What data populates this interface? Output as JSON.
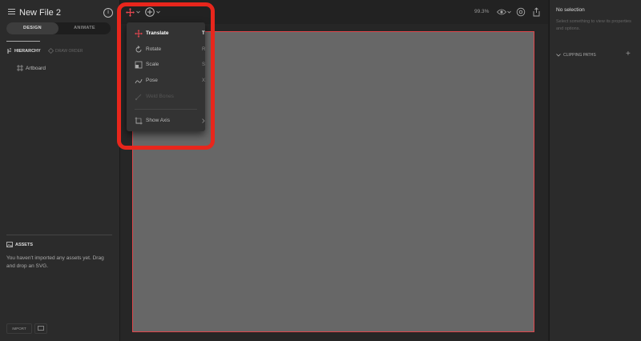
{
  "app": {
    "title": "New File 2"
  },
  "left_panel": {
    "mode_tabs": [
      "DESIGN",
      "ANIMATE"
    ],
    "view_tabs": [
      "HIERARCHY",
      "DRAW ORDER"
    ],
    "hierarchy_items": [
      "Artboard"
    ],
    "assets": {
      "heading": "ASSETS",
      "message": "You haven't imported any assets yet. Drag and drop an SVG.",
      "import_label": "IMPORT"
    }
  },
  "toolbar": {
    "zoom": "99.3%"
  },
  "transform_menu": {
    "items": [
      {
        "label": "Translate",
        "key": "T",
        "active": true,
        "disabled": false
      },
      {
        "label": "Rotate",
        "key": "R",
        "active": false,
        "disabled": false
      },
      {
        "label": "Scale",
        "key": "S",
        "active": false,
        "disabled": false
      },
      {
        "label": "Pose",
        "key": "X",
        "active": false,
        "disabled": false
      },
      {
        "label": "Weld Bones",
        "key": "",
        "active": false,
        "disabled": true
      }
    ],
    "show_axis": "Show Axis"
  },
  "right_panel": {
    "heading": "No selection",
    "message": "Select something to view its properties and options.",
    "clipping_paths": "CLIPPING PATHS"
  },
  "colors": {
    "accent": "#e8261c",
    "artboard": "#676767",
    "artboard_border": "#e0474c"
  }
}
